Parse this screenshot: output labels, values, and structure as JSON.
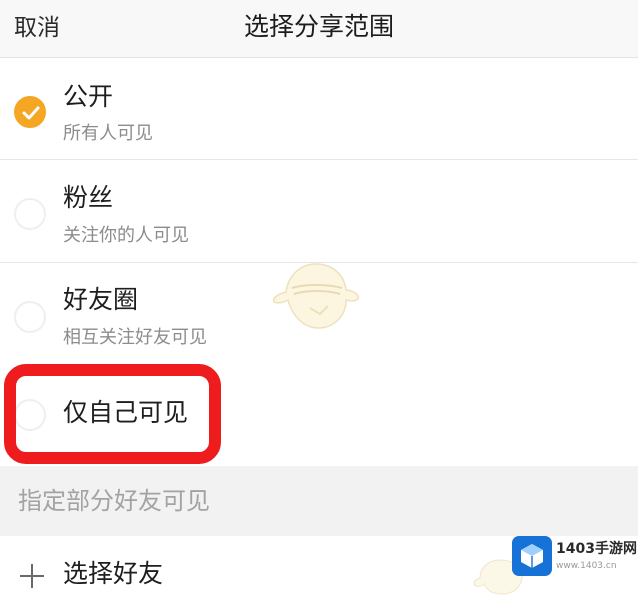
{
  "nav": {
    "cancel_label": "取消",
    "title": "选择分享范围"
  },
  "options": [
    {
      "title": "公开",
      "subtitle": "所有人可见",
      "checked": true
    },
    {
      "title": "粉丝",
      "subtitle": "关注你的人可见",
      "checked": false
    },
    {
      "title": "好友圈",
      "subtitle": "相互关注好友可见",
      "checked": false
    },
    {
      "title": "仅自己可见",
      "checked": false
    }
  ],
  "section": {
    "header": "指定部分好友可见",
    "select_friends_label": "选择好友"
  },
  "watermark": {
    "brand": "1403手游网",
    "url": "www.1403.cn"
  },
  "colors": {
    "accent": "#f5a623",
    "highlight": "#ee1c1c",
    "logo_blue": "#1672d6"
  }
}
